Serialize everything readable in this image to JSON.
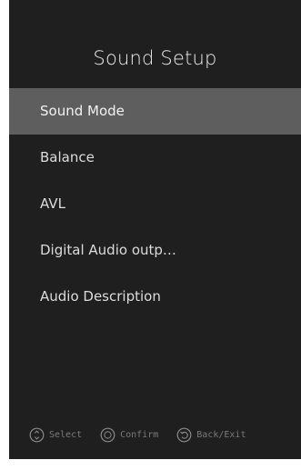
{
  "page": {
    "title": "Sound Setup"
  },
  "menu": {
    "items": [
      {
        "label": "Sound Mode",
        "selected": true
      },
      {
        "label": "Balance",
        "selected": false
      },
      {
        "label": "AVL",
        "selected": false
      },
      {
        "label": "Digital Audio outp…",
        "selected": false
      },
      {
        "label": "Audio Description",
        "selected": false
      }
    ]
  },
  "footer": {
    "select_label": "Select",
    "confirm_label": "Confirm",
    "back_label": "Back/Exit",
    "select_icon": "up-down-nav-icon",
    "confirm_icon": "ok-button-icon",
    "back_icon": "back-arrow-icon"
  },
  "colors": {
    "background": "#1f1f1f",
    "highlight": "#5e5e5e",
    "text": "#dcdcdc",
    "hint_text": "#7a7a7a"
  }
}
